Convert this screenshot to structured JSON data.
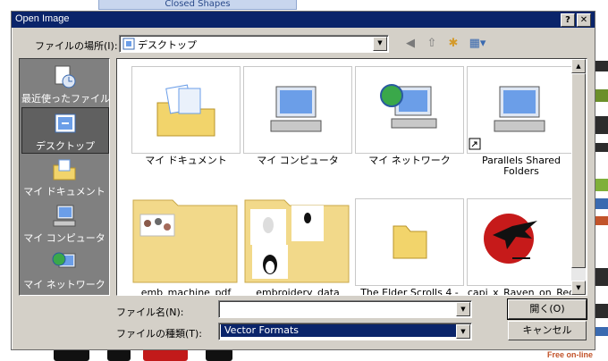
{
  "background": {
    "tab_label": "Closed Shapes",
    "free_text": "Free on-line"
  },
  "dialog": {
    "title": "Open Image",
    "help_label": "?",
    "close_label": "✕",
    "look_in_label": "ファイルの場所(I):",
    "look_in_value": "デスクトップ",
    "toolbar_icons": [
      "back-icon",
      "up-folder-icon",
      "new-folder-icon",
      "view-menu-icon"
    ],
    "places": [
      {
        "label": "最近使ったファイル",
        "icon": "recent-files-icon"
      },
      {
        "label": "デスクトップ",
        "icon": "desktop-icon"
      },
      {
        "label": "マイ ドキュメント",
        "icon": "my-documents-icon"
      },
      {
        "label": "マイ コンピュータ",
        "icon": "my-computer-icon"
      },
      {
        "label": "マイ ネットワーク",
        "icon": "my-network-icon"
      }
    ],
    "files": [
      {
        "name": "マイ ドキュメント",
        "icon": "my-documents-icon"
      },
      {
        "name": "マイ コンピュータ",
        "icon": "my-computer-icon"
      },
      {
        "name": "マイ ネットワーク",
        "icon": "my-network-icon"
      },
      {
        "name": "Parallels Shared Folders",
        "icon": "shortcut-computer-icon"
      },
      {
        "name": "emb_machine_pdf",
        "icon": "folder-thumbnail-icon"
      },
      {
        "name": "embroidery_data",
        "icon": "folder-thumbnail-icon"
      },
      {
        "name": "The Elder Scrolls 4 -",
        "icon": "folder-icon"
      },
      {
        "name": "capi_x_Raven_on_Red",
        "icon": "raven-image-icon"
      }
    ],
    "filename_label": "ファイル名(N):",
    "filename_value": "",
    "filetype_label": "ファイルの種類(T):",
    "filetype_value": "Vector Formats",
    "open_button": "開く(O)",
    "cancel_button": "キャンセル"
  },
  "colors": {
    "titlebar": "#0a246a",
    "dialog_face": "#d4d0c8",
    "places_bar": "#808080",
    "selection": "#0a246a"
  }
}
